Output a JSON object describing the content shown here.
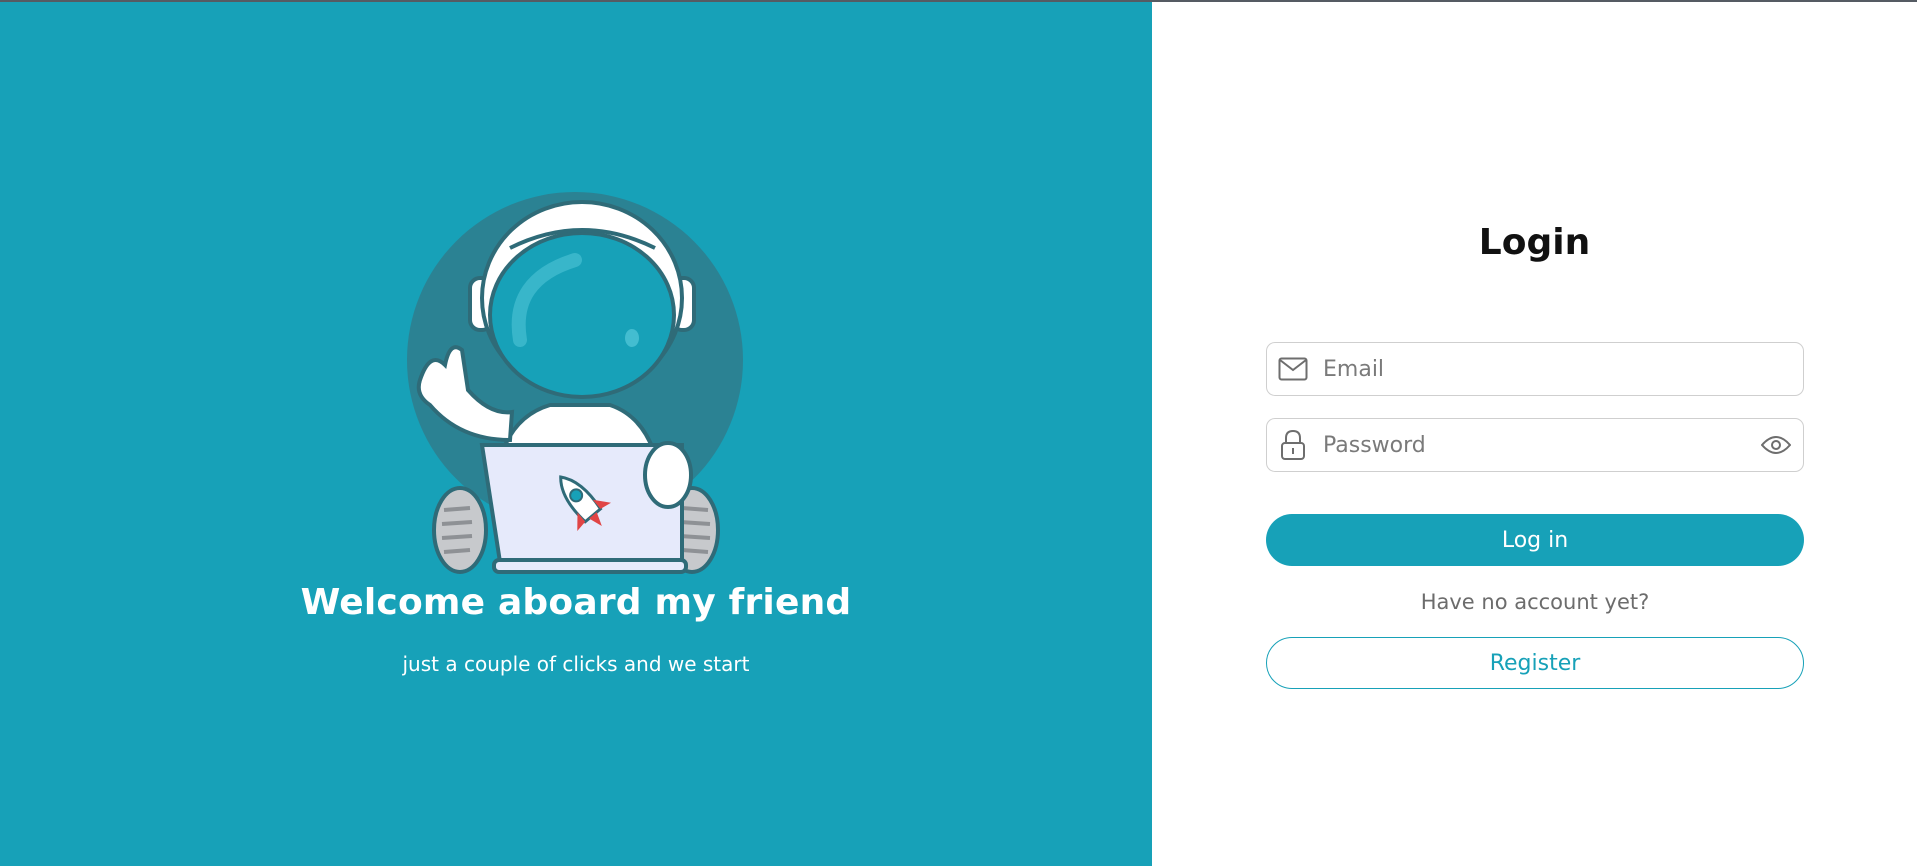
{
  "colors": {
    "accent": "#17a1b8",
    "background_right": "#ffffff",
    "text_dark": "#111111",
    "text_muted": "#6c6c6c"
  },
  "hero": {
    "illustration": "astronaut-with-laptop-illustration",
    "title": "Welcome aboard my friend",
    "subtitle": "just a couple of clicks and we start"
  },
  "login": {
    "title": "Login",
    "email": {
      "icon": "envelope-icon",
      "placeholder": "Email",
      "value": ""
    },
    "password": {
      "icon": "lock-icon",
      "placeholder": "Password",
      "value": "",
      "toggle_icon": "eye-icon"
    },
    "submit_label": "Log in",
    "no_account_text": "Have no account yet?",
    "register_label": "Register"
  }
}
